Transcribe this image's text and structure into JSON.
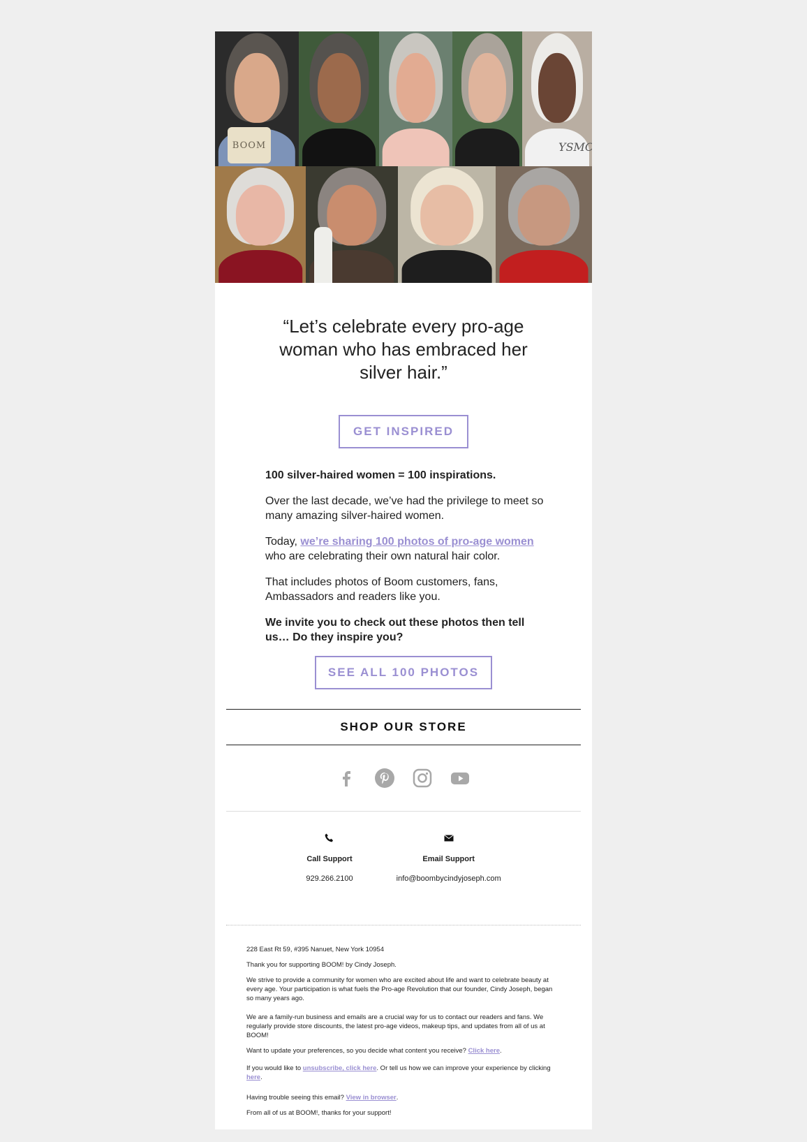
{
  "hero": {
    "bag_text": "BOOM",
    "shirt_text": "YSMC"
  },
  "quote": "“Let’s celebrate every pro-age woman who has embraced her silver hair.”",
  "buttons": {
    "get_inspired": "GET INSPIRED",
    "see_all": "SEE ALL 100 PHOTOS"
  },
  "copy": {
    "p1": "100 silver-haired women = 100 inspirations.",
    "p2": "Over the last decade, we’ve had the privilege to meet so many amazing silver-haired women.",
    "p3_lead": "Today, ",
    "p3_link": "we’re sharing 100 photos of pro-age women",
    "p3_tail": " who are celebrating their own natural hair color.",
    "p4": "That includes photos of Boom customers, fans, Ambassadors and readers like you.",
    "p5": "We invite you to check out these photos then tell us… Do they inspire you?"
  },
  "shop_label": "SHOP OUR STORE",
  "social": [
    "facebook-icon",
    "pinterest-icon",
    "instagram-icon",
    "youtube-icon"
  ],
  "support": {
    "call_title": "Call Support",
    "call_value": "929.266.2100",
    "email_title": "Email Support",
    "email_value": "info@boombycindyjoseph.com"
  },
  "footer": {
    "address": "228 East Rt 59, #395 Nanuet, New York 10954",
    "thanks": "Thank you for supporting BOOM! by Cindy Joseph.",
    "strive": "We strive to provide a community for women who are excited about life and want to celebrate beauty at every age. Your participation is what fuels the Pro-age Revolution that our founder, Cindy Joseph, began so many years ago.",
    "family": "We are a family-run business and emails are a crucial way for us to contact our readers and fans. We regularly provide store discounts, the latest pro-age videos, makeup tips, and updates from all of us at BOOM!",
    "prefs_lead": "Want to update your preferences, so you decide what content you receive? ",
    "prefs_link": "Click here",
    "prefs_tail": ".",
    "unsub_lead": "If you would like to ",
    "unsub_link": "unsubscribe, click here",
    "unsub_mid": ". Or tell us how we can improve your experience by clicking ",
    "unsub_link2": "here",
    "unsub_tail": ".",
    "trouble_lead": "Having trouble seeing this email? ",
    "trouble_link": "View in browser",
    "trouble_tail": ".",
    "signoff": "From all of us at BOOM!, thanks for your support!"
  },
  "colors": {
    "accent": "#9a8fd2",
    "page_bg": "#efefef",
    "text": "#222222"
  }
}
